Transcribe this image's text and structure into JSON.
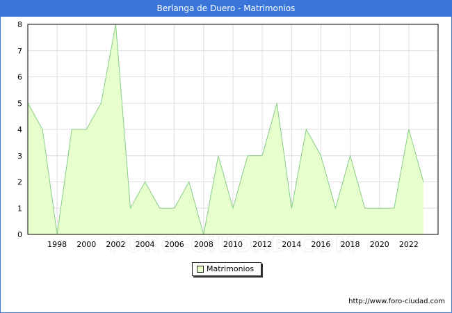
{
  "title": "Berlanga de Duero - Matrimonios",
  "source": "http://www.foro-ciudad.com",
  "watermark": "FORO-CIUDAD.COM",
  "colors": {
    "title_bg": "#3a75d9",
    "area_fill": "#e6ffcc",
    "line": "#88cc88",
    "grid": "#dddddd"
  },
  "chart_data": {
    "type": "area",
    "title": "Berlanga de Duero - Matrimonios",
    "xlabel": "",
    "ylabel": "",
    "x": [
      1996,
      1997,
      1998,
      1999,
      2000,
      2001,
      2002,
      2003,
      2004,
      2005,
      2006,
      2007,
      2008,
      2009,
      2010,
      2011,
      2012,
      2013,
      2014,
      2015,
      2016,
      2017,
      2018,
      2019,
      2020,
      2021,
      2022,
      2023
    ],
    "series": [
      {
        "name": "Matrimonios",
        "values": [
          5,
          4,
          0,
          4,
          4,
          5,
          8,
          1,
          2,
          1,
          1,
          2,
          0,
          3,
          1,
          3,
          3,
          5,
          1,
          4,
          3,
          1,
          3,
          1,
          1,
          1,
          4,
          2
        ]
      }
    ],
    "xticks": [
      "1998",
      "2000",
      "2002",
      "2004",
      "2006",
      "2008",
      "2010",
      "2012",
      "2014",
      "2016",
      "2018",
      "2020",
      "2022"
    ],
    "yticks": [
      "0",
      "1",
      "2",
      "3",
      "4",
      "5",
      "6",
      "7",
      "8"
    ],
    "xlim": [
      1996,
      2024
    ],
    "ylim": [
      0,
      8
    ],
    "grid": true,
    "legend": "bottom-center"
  }
}
